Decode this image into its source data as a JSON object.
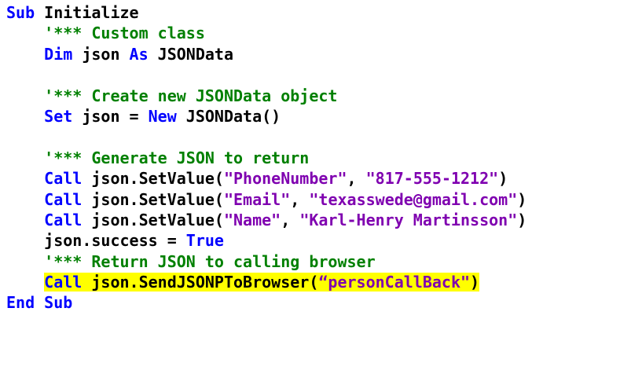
{
  "colors": {
    "keyword": "#0000ff",
    "comment": "#008000",
    "string": "#7f00b0",
    "text": "#000000",
    "highlight": "#ffff00"
  },
  "code": {
    "l1": {
      "kw": "Sub",
      "rest": " Initialize"
    },
    "l2": {
      "comment": "'*** Custom class"
    },
    "l3": {
      "kw1": "Dim",
      "mid": " json ",
      "kw2": "As",
      "rest": " JSONData"
    },
    "l5": {
      "comment": "'*** Create new JSONData object"
    },
    "l6": {
      "kw1": "Set",
      "mid": " json = ",
      "kw2": "New",
      "rest": " JSONData()"
    },
    "l8": {
      "comment": "'*** Generate JSON to return"
    },
    "l9": {
      "kw": "Call",
      "call": " json.SetValue(",
      "s1": "\"PhoneNumber\"",
      "sep": ", ",
      "s2": "\"817-555-1212\"",
      "close": ")"
    },
    "l10": {
      "kw": "Call",
      "call": " json.SetValue(",
      "s1": "\"Email\"",
      "sep": ", ",
      "s2": "\"texasswede@gmail.com\"",
      "close": ")"
    },
    "l11": {
      "kw": "Call",
      "call": " json.SetValue(",
      "s1": "\"Name\"",
      "sep": ", ",
      "s2": "\"Karl-Henry Martinsson\"",
      "close": ")"
    },
    "l12": {
      "pre": "json.success = ",
      "kw": "True"
    },
    "l13": {
      "comment": "'*** Return JSON to calling browser"
    },
    "l14": {
      "kw": "Call",
      "call": " json.SendJSONPToBrowser(",
      "s1": "“personCallBack\"",
      "close": ")"
    },
    "l15": {
      "kw1": "End",
      "sp": " ",
      "kw2": "Sub"
    }
  }
}
